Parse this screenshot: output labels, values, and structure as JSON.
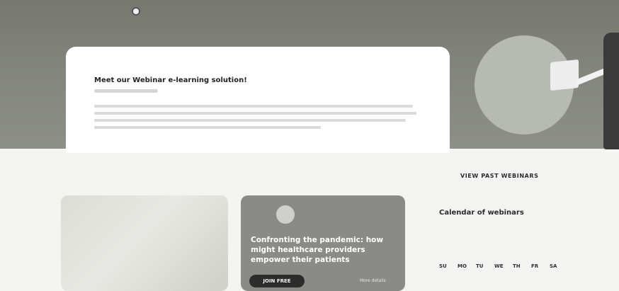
{
  "hero": {
    "title": "Meet our Webinar e-learning solution!"
  },
  "webinars": {
    "view_past_label": "VIEW PAST WEBINARS",
    "cards": [
      {
        "title": ""
      },
      {
        "title": "Confronting the pandemic: how might healthcare providers empower their patients",
        "join_label": "JOIN FREE",
        "more_label": "More details"
      }
    ]
  },
  "calendar": {
    "title": "Calendar of webinars",
    "days": [
      "SU",
      "MO",
      "TU",
      "WE",
      "TH",
      "FR",
      "SA"
    ]
  }
}
